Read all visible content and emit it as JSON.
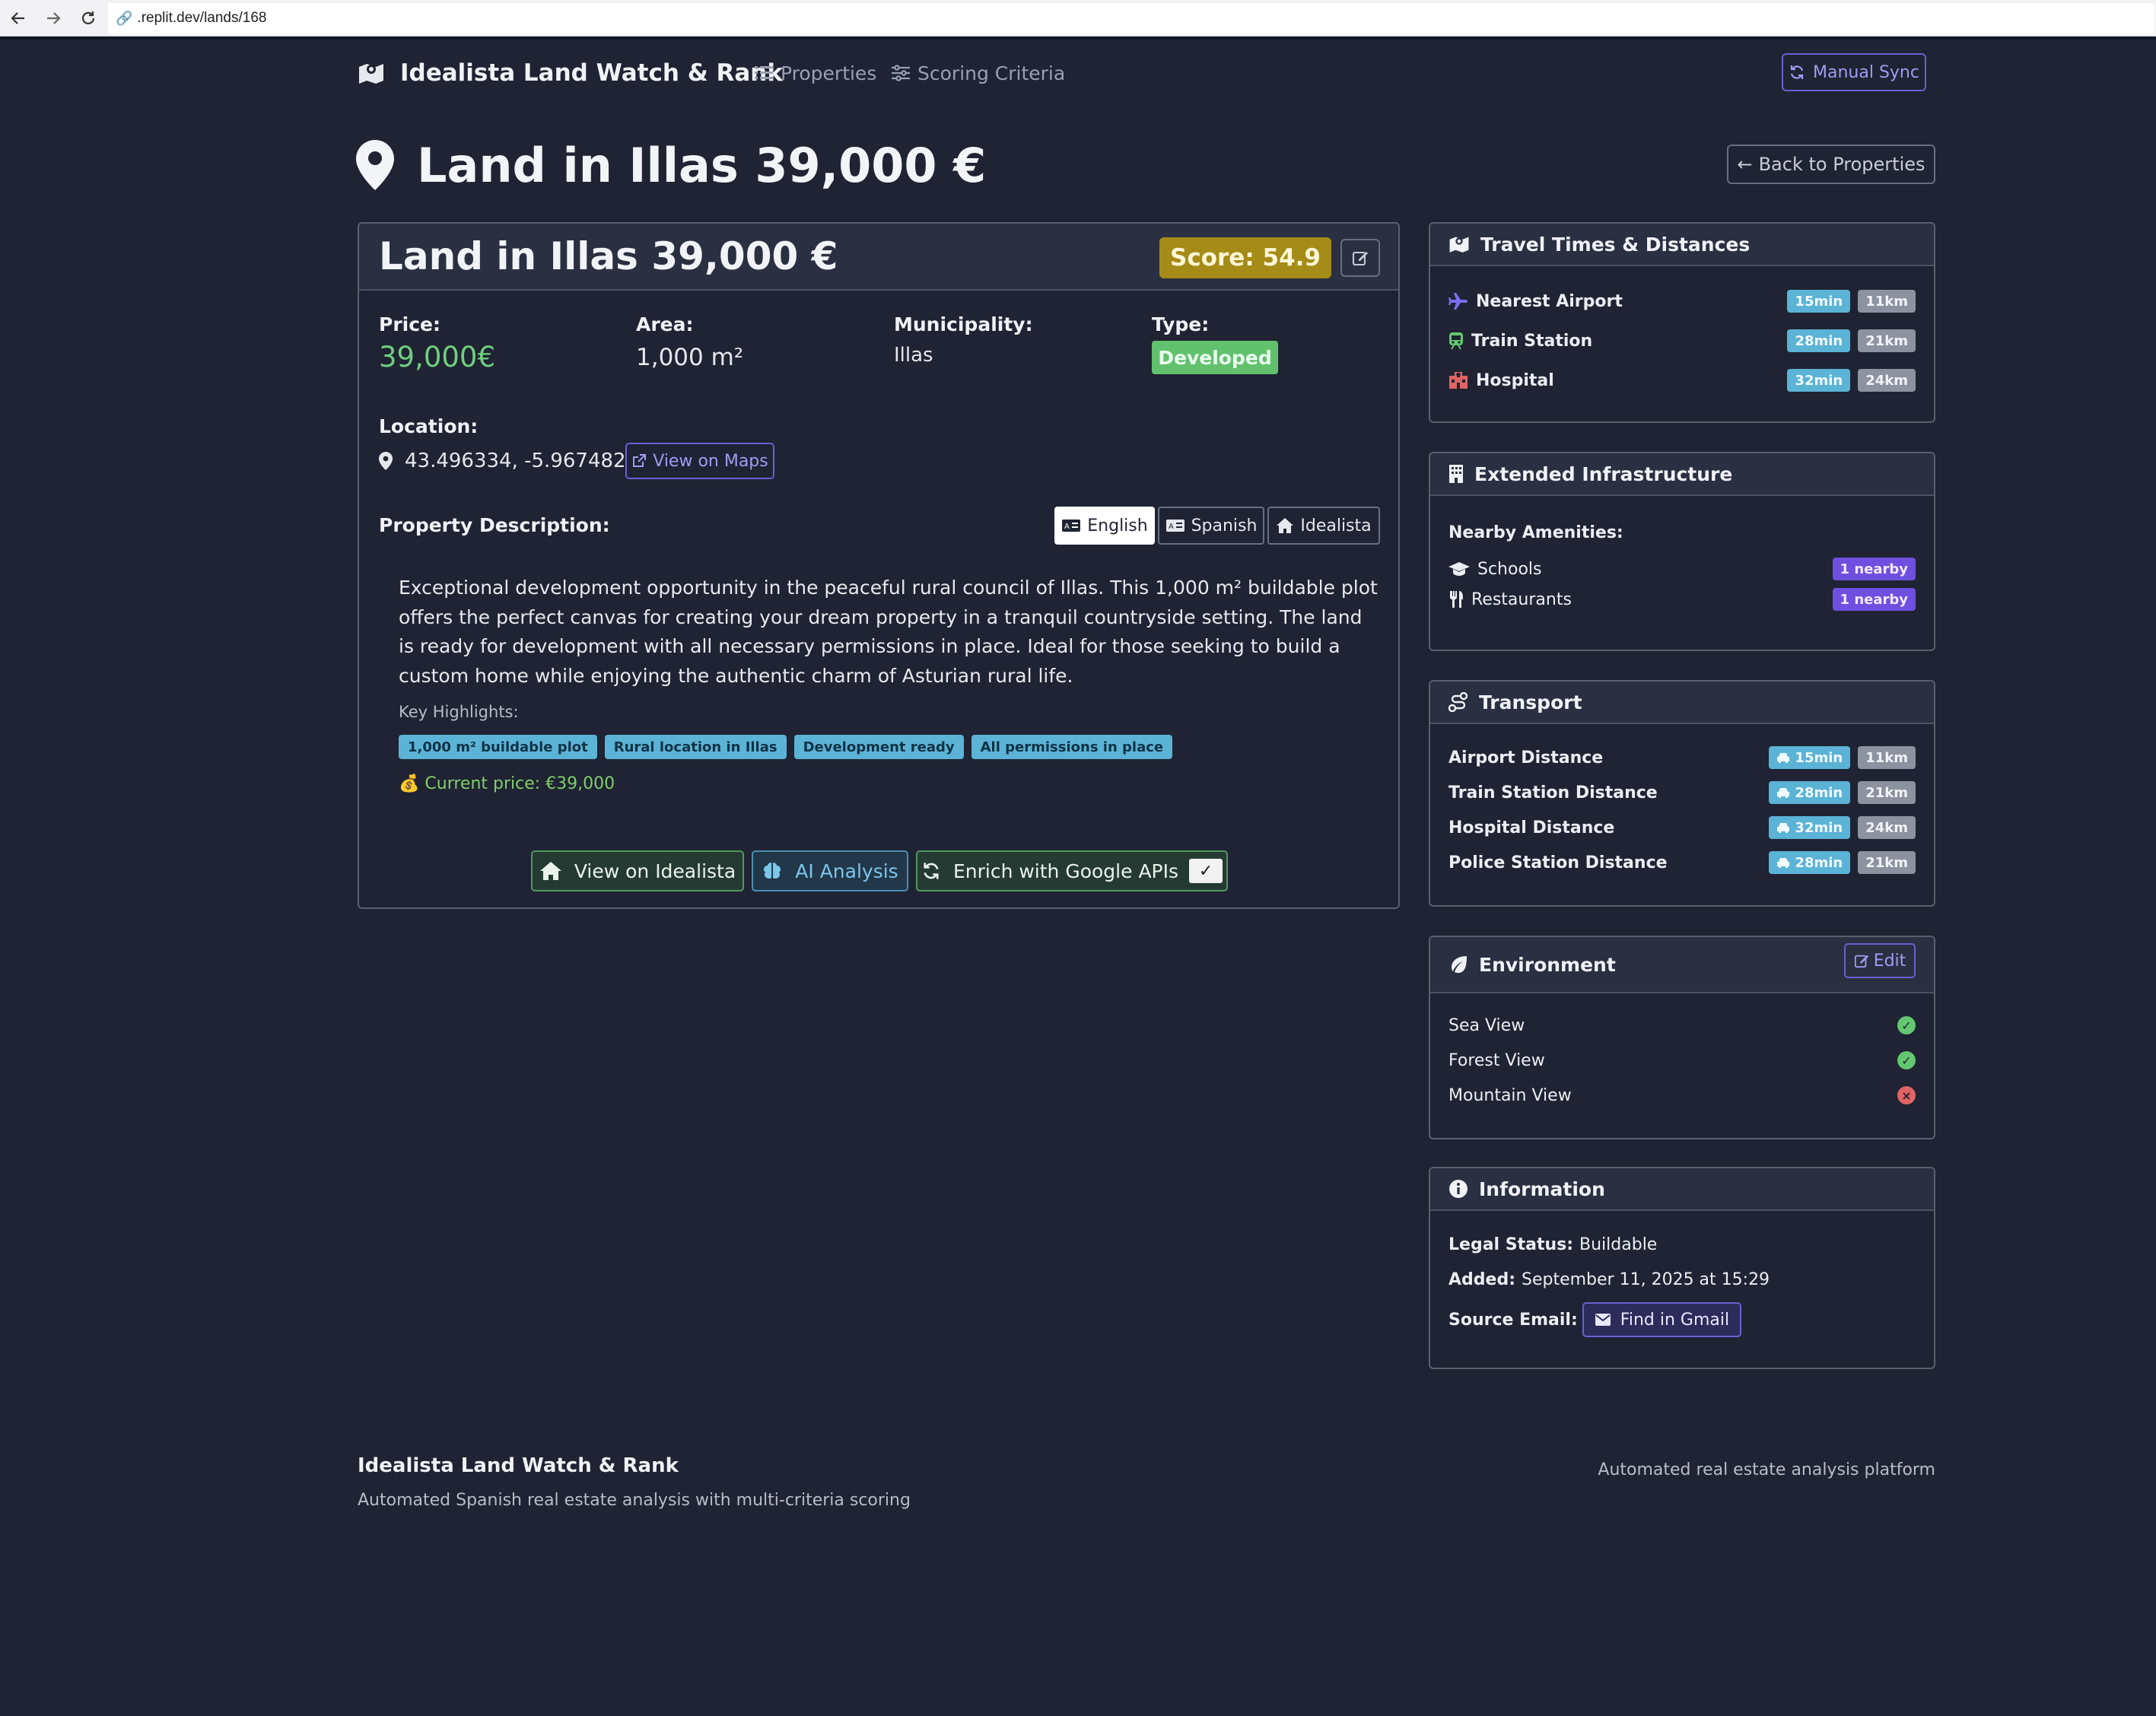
{
  "browser": {
    "url": ".replit.dev/lands/168"
  },
  "navbar": {
    "brand": "Idealista Land Watch & Rank",
    "links": [
      "Properties",
      "Scoring Criteria"
    ],
    "sync_label": "Manual Sync"
  },
  "page": {
    "title": "Land in Illas 39,000 €",
    "back_label": "Back to Properties"
  },
  "property": {
    "title": "Land in Illas 39,000 €",
    "score": "Score: 54.9",
    "price_label": "Price:",
    "price": "39,000€",
    "area_label": "Area:",
    "area": "1,000 m²",
    "municipality_label": "Municipality:",
    "municipality": "Illas",
    "type_label": "Type:",
    "type": "Developed",
    "location_label": "Location:",
    "coordinates": "43.496334, -5.967482",
    "maps_label": "View on Maps",
    "description_label": "Property Description:",
    "lang_tabs": [
      "English",
      "Spanish",
      "Idealista"
    ],
    "description": "Exceptional development opportunity in the peaceful rural council of Illas. This 1,000 m² buildable plot offers the perfect canvas for creating your dream property in a tranquil countryside setting. The land is ready for development with all necessary permissions in place. Ideal for those seeking to build a custom home while enjoying the authentic charm of Asturian rural life.",
    "highlights_label": "Key Highlights:",
    "highlights": [
      "1,000 m² buildable plot",
      "Rural location in Illas",
      "Development ready",
      "All permissions in place"
    ],
    "current_price": "💰 Current price: €39,000",
    "actions": {
      "idealista": "View on Idealista",
      "ai": "AI Analysis",
      "enrich": "Enrich with Google APIs",
      "enrich_check": "✓"
    }
  },
  "travel": {
    "title": "Travel Times & Distances",
    "rows": [
      {
        "label": "Nearest Airport",
        "time": "15min",
        "dist": "11km"
      },
      {
        "label": "Train Station",
        "time": "28min",
        "dist": "21km"
      },
      {
        "label": "Hospital",
        "time": "32min",
        "dist": "24km"
      }
    ]
  },
  "infrastructure": {
    "title": "Extended Infrastructure",
    "amenities_label": "Nearby Amenities:",
    "rows": [
      {
        "label": "Schools",
        "badge": "1 nearby"
      },
      {
        "label": "Restaurants",
        "badge": "1 nearby"
      }
    ]
  },
  "transport": {
    "title": "Transport",
    "rows": [
      {
        "label": "Airport Distance",
        "time": "15min",
        "dist": "11km"
      },
      {
        "label": "Train Station Distance",
        "time": "28min",
        "dist": "21km"
      },
      {
        "label": "Hospital Distance",
        "time": "32min",
        "dist": "24km"
      },
      {
        "label": "Police Station Distance",
        "time": "28min",
        "dist": "21km"
      }
    ]
  },
  "environment": {
    "title": "Environment",
    "edit_label": "Edit",
    "rows": [
      {
        "label": "Sea View",
        "status": "✓"
      },
      {
        "label": "Forest View",
        "status": "✓"
      },
      {
        "label": "Mountain View",
        "status": "×"
      }
    ]
  },
  "information": {
    "title": "Information",
    "legal_label": "Legal Status:",
    "legal_value": "Buildable",
    "added_label": "Added:",
    "added_value": "September 11, 2025 at 15:29",
    "email_label": "Source Email:",
    "gmail_label": "Find in Gmail"
  },
  "footer": {
    "title": "Idealista Land Watch & Rank",
    "subtitle": "Automated Spanish real estate analysis with multi-criteria scoring",
    "right": "Automated real estate analysis platform"
  },
  "colors": {
    "background": "#1f2333",
    "accent": "#6b5fd1",
    "score": "#a58b17",
    "success": "#63c76f",
    "danger": "#e06464",
    "info": "#5bb3d6"
  }
}
